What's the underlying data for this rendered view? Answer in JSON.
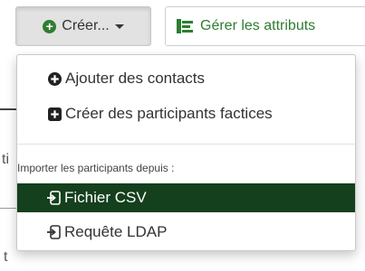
{
  "toolbar": {
    "create_label": "Créer...",
    "attributes_label": "Gérer les attributs"
  },
  "background": {
    "fragment_1": "ti",
    "fragment_2": "t"
  },
  "menu": {
    "items": [
      {
        "label": "Ajouter des contacts",
        "icon": "plus-circle-icon"
      },
      {
        "label": "Créer des participants factices",
        "icon": "plus-square-icon"
      }
    ],
    "section_header": "Importer les participants depuis :",
    "import_items": [
      {
        "label": "Fichier CSV",
        "icon": "import-icon",
        "active": true
      },
      {
        "label": "Requête LDAP",
        "icon": "import-icon",
        "active": false
      }
    ]
  },
  "colors": {
    "accent_green": "#2e7d32",
    "active_item_bg": "#14401d"
  }
}
